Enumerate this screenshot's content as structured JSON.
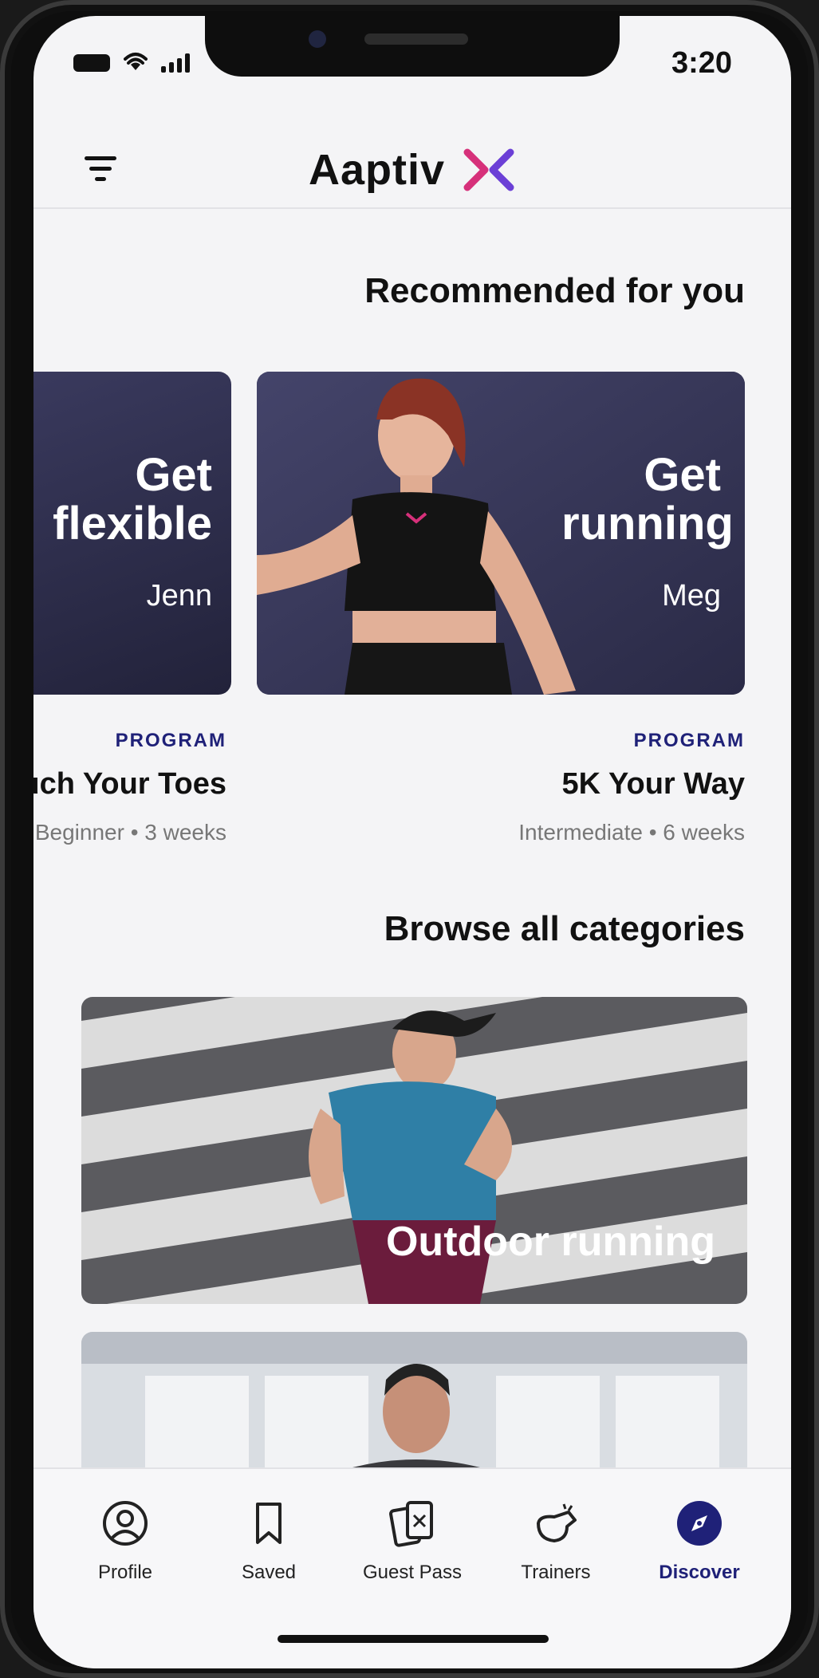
{
  "status": {
    "time": "3:20"
  },
  "brand": {
    "name": "Aaptiv",
    "accent": "#6b3fd6",
    "accent2": "#d6307a",
    "nav_active": "#1f2178"
  },
  "recommended": {
    "title": "Recommended for you",
    "cards": [
      {
        "overlay_title": "Get running",
        "trainer": "Meg",
        "type": "PROGRAM",
        "name": "5K Your Way",
        "meta": "Intermediate • 6 weeks"
      },
      {
        "overlay_title": "Get flexible",
        "trainer": "Jenn",
        "type": "PROGRAM",
        "name": "Touch Your Toes",
        "meta": "Beginner • 3 weeks"
      }
    ]
  },
  "browse": {
    "title": "Browse all categories",
    "categories": [
      {
        "label": "Outdoor running"
      },
      {
        "label": ""
      }
    ]
  },
  "tabs": [
    {
      "label": "Discover",
      "icon": "compass-icon",
      "active": true
    },
    {
      "label": "Trainers",
      "icon": "whistle-icon",
      "active": false
    },
    {
      "label": "Guest Pass",
      "icon": "guest-pass-icon",
      "active": false
    },
    {
      "label": "Saved",
      "icon": "bookmark-icon",
      "active": false
    },
    {
      "label": "Profile",
      "icon": "profile-icon",
      "active": false
    }
  ]
}
